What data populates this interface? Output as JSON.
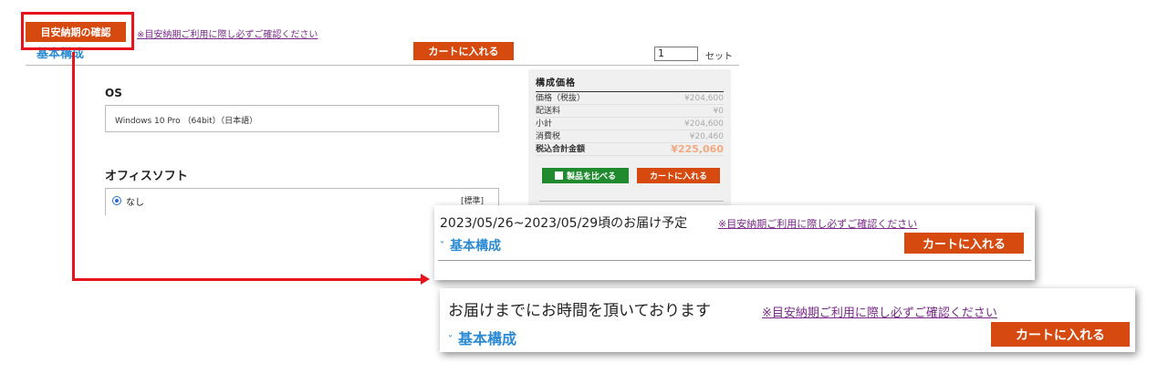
{
  "header": {
    "estimate_button": "目安納期の確認",
    "note_link": "※目安納期ご利用に際し必ずご確認ください",
    "section": "基本構成",
    "cart_button": "カートに入れる",
    "qty_value": "1",
    "qty_unit": "セット"
  },
  "config": {
    "os_label": "OS",
    "os_value": "Windows 10 Pro （64bit）（日本語）",
    "office_label": "オフィスソフト",
    "office_option": "なし",
    "office_tag": "[標準]"
  },
  "price_panel": {
    "title": "構成価格",
    "rows": [
      {
        "label": "価格（税抜）",
        "value": "¥204,600"
      },
      {
        "label": "配送料",
        "value": "¥0"
      },
      {
        "label": "小計",
        "value": "¥204,600"
      },
      {
        "label": "消費税",
        "value": "¥20,460"
      }
    ],
    "total_label": "税込合計金額",
    "total_value": "¥225,060",
    "compare_button": "製品を比べる",
    "cart_button": "カートに入れる"
  },
  "callout1": {
    "date_text": "2023/05/26~2023/05/29頃のお届け予定",
    "note_link": "※目安納期ご利用に際し必ずご確認ください",
    "chevron": "˅",
    "section": "基本構成",
    "cart_button": "カートに入れる"
  },
  "callout2": {
    "message": "お届けまでにお時間を頂いております",
    "note_link": "※目安納期ご利用に際し必ずご確認ください",
    "chevron": "˅",
    "section": "基本構成",
    "cart_button": "カートに入れる"
  },
  "colors": {
    "accent_orange": "#d64a10",
    "highlight_red": "#e8141c",
    "link_purple": "#7a2a8a",
    "heading_blue": "#2a8ad4",
    "compare_green": "#1f8a2e"
  }
}
